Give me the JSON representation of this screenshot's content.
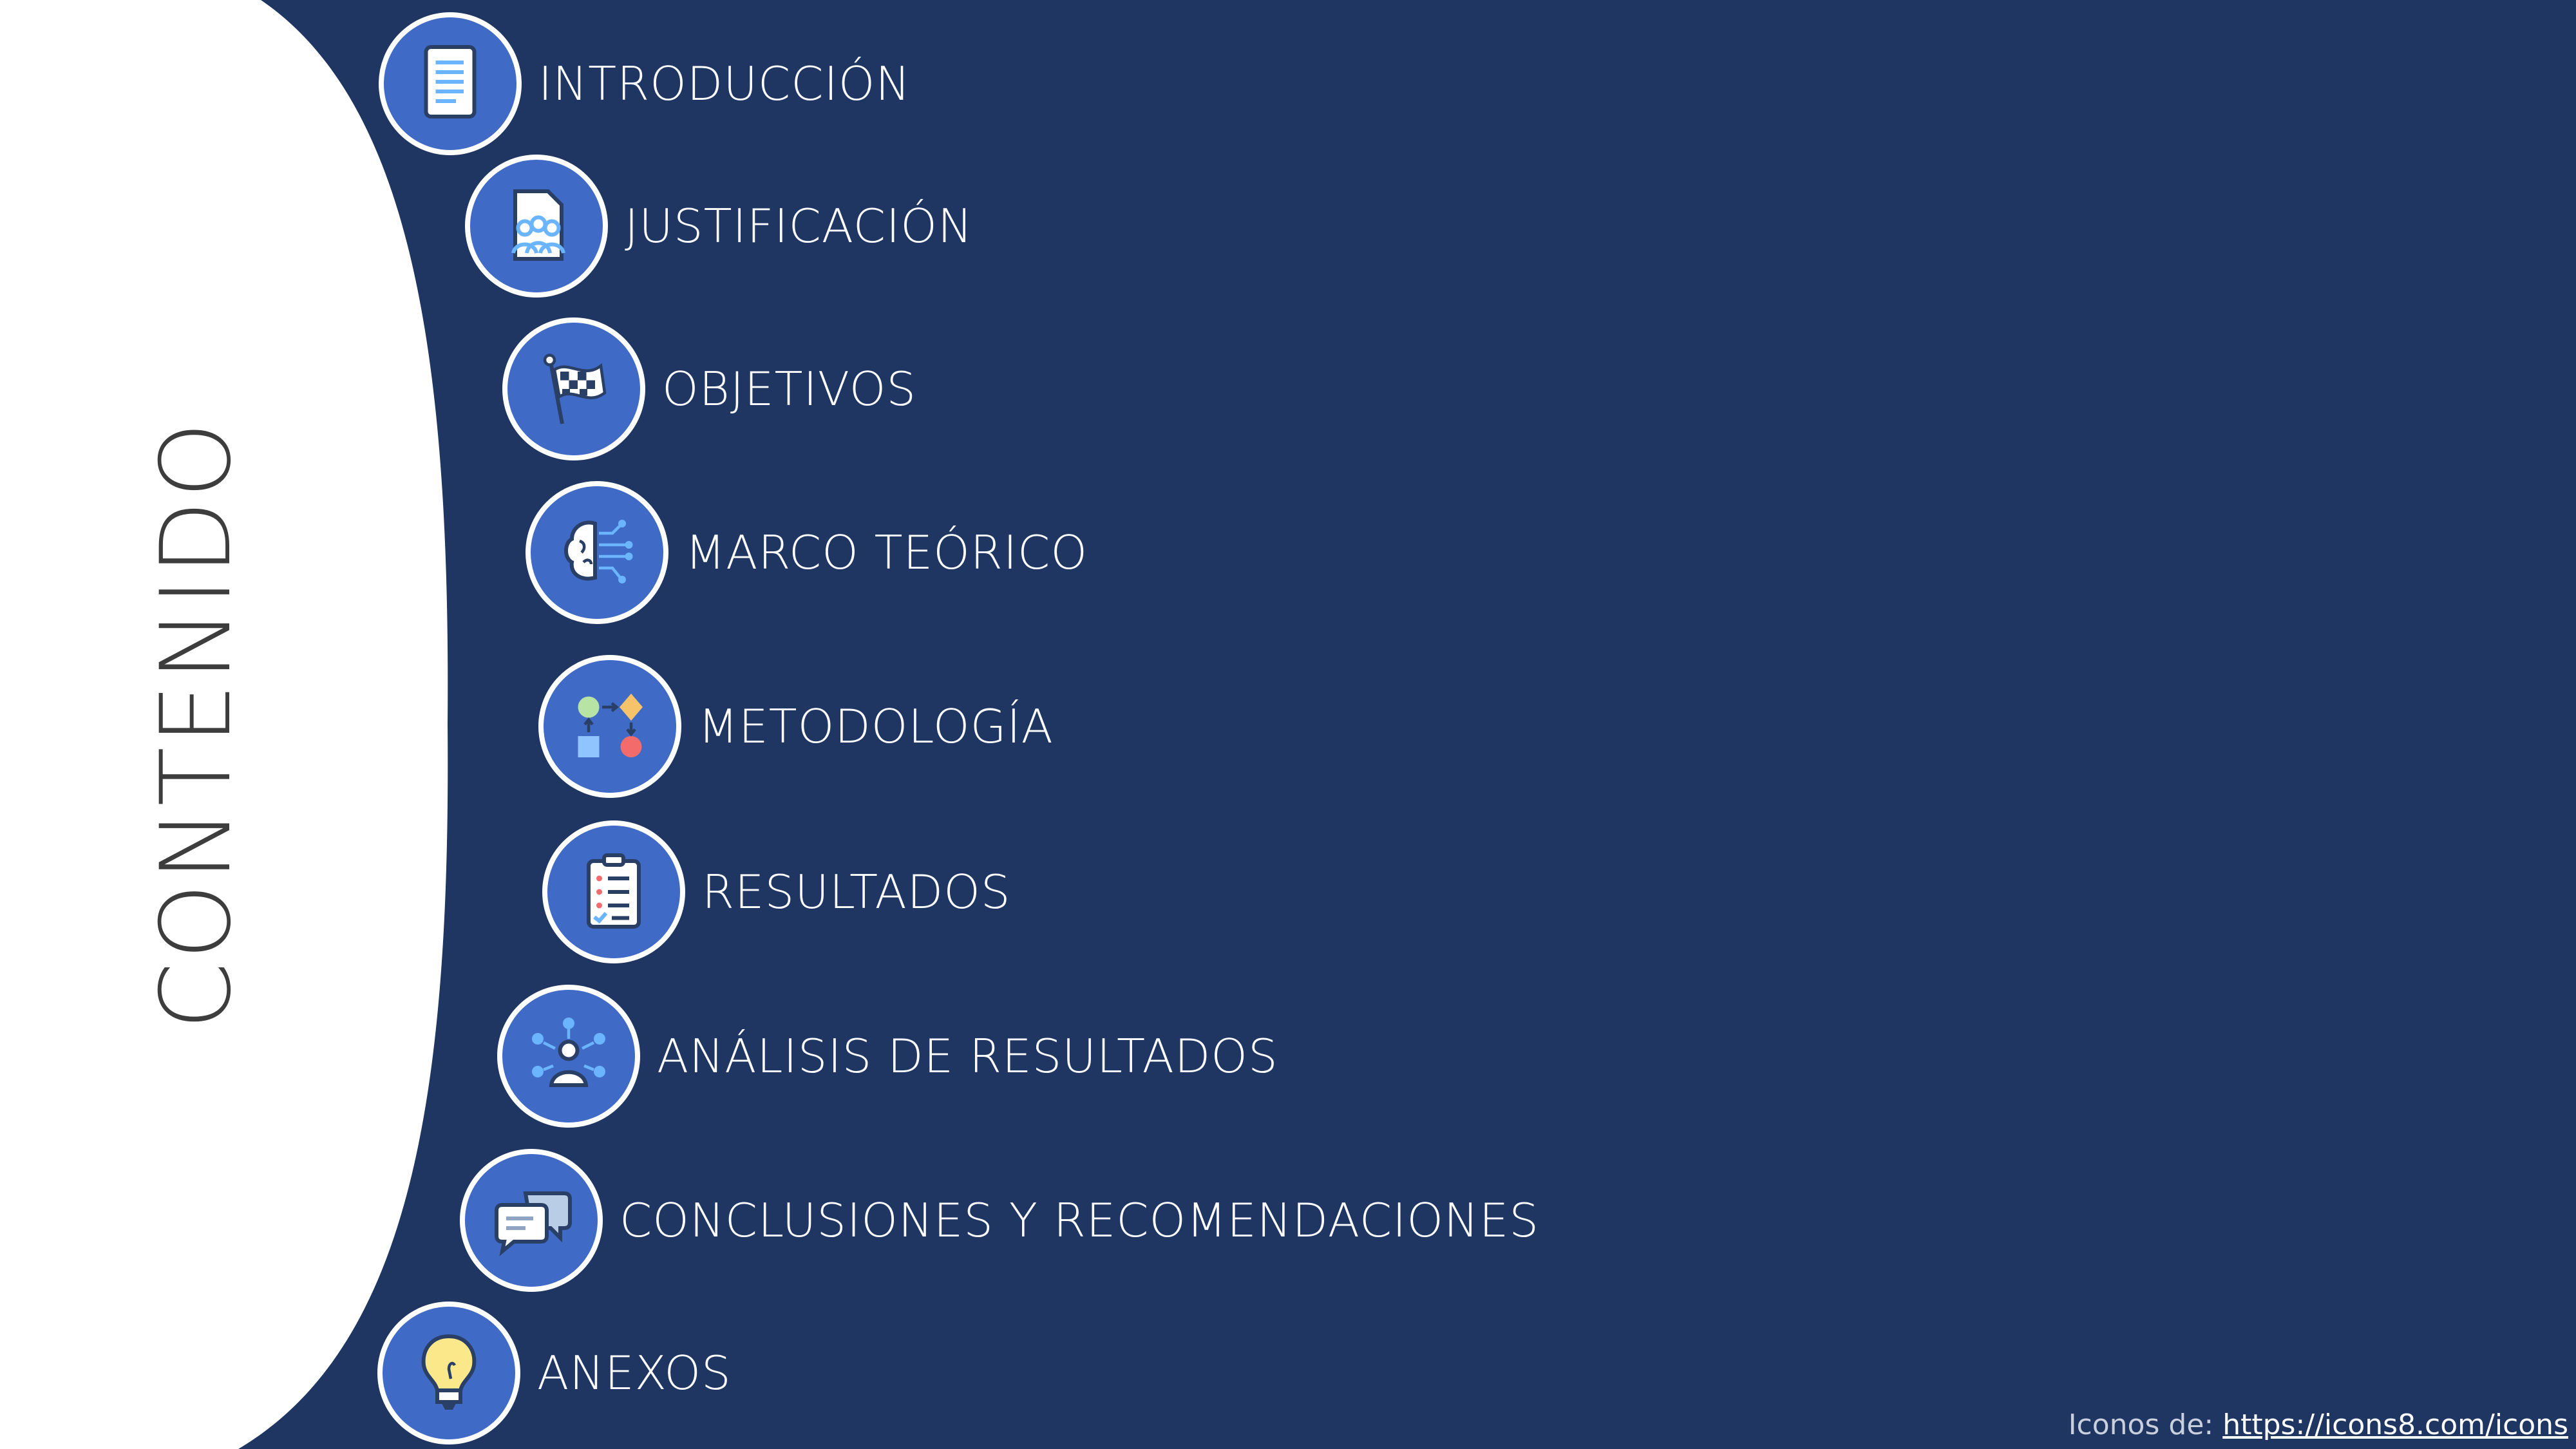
{
  "title": "CONTENIDO",
  "items": [
    {
      "label": "INTRODUCCIÓN",
      "icon": "document-icon"
    },
    {
      "label": "JUSTIFICACIÓN",
      "icon": "group-document-icon"
    },
    {
      "label": "OBJETIVOS",
      "icon": "checkered-flag-icon"
    },
    {
      "label": "MARCO TEÓRICO",
      "icon": "brain-circuit-icon"
    },
    {
      "label": "METODOLOGÍA",
      "icon": "flowchart-icon"
    },
    {
      "label": "RESULTADOS",
      "icon": "clipboard-checklist-icon"
    },
    {
      "label": "ANÁLISIS DE RESULTADOS",
      "icon": "user-network-icon"
    },
    {
      "label": "CONCLUSIONES Y RECOMENDACIONES",
      "icon": "chat-bubbles-icon"
    },
    {
      "label": "ANEXOS",
      "icon": "lightbulb-icon"
    }
  ],
  "footer": {
    "prefix": "Iconos de: ",
    "link": "https://icons8.com/icons"
  },
  "colors": {
    "background": "#1f3663",
    "icon_circle": "#3f6ac6",
    "panel": "#ffffff"
  }
}
